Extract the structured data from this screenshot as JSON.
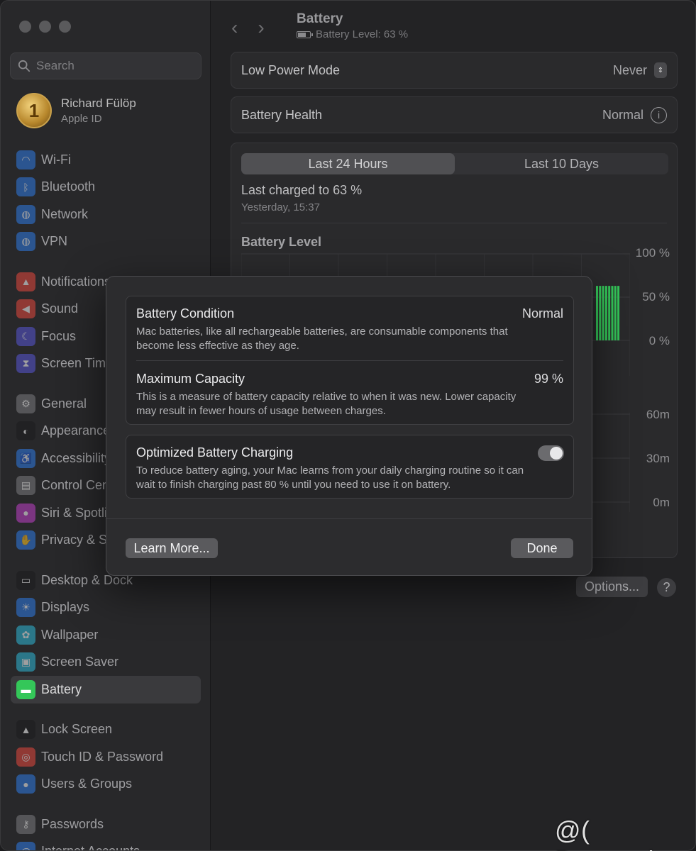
{
  "search": {
    "placeholder": "Search"
  },
  "profile": {
    "name": "Richard Fülöp",
    "subtitle": "Apple ID",
    "avatar_text": "1"
  },
  "sidebar": {
    "groups": [
      [
        {
          "label": "Wi-Fi",
          "icon": "wifi-icon",
          "color": "#2f7ae5"
        },
        {
          "label": "Bluetooth",
          "icon": "bluetooth-icon",
          "color": "#2f7ae5"
        },
        {
          "label": "Network",
          "icon": "globe-icon",
          "color": "#2f7ae5"
        },
        {
          "label": "VPN",
          "icon": "vpn-icon",
          "color": "#2f7ae5"
        }
      ],
      [
        {
          "label": "Notifications",
          "icon": "bell-icon",
          "color": "#e5483d"
        },
        {
          "label": "Sound",
          "icon": "speaker-icon",
          "color": "#e5483d"
        },
        {
          "label": "Focus",
          "icon": "moon-icon",
          "color": "#5856d6"
        },
        {
          "label": "Screen Time",
          "icon": "hourglass-icon",
          "color": "#5856d6"
        }
      ],
      [
        {
          "label": "General",
          "icon": "gear-icon",
          "color": "#7b7b7e"
        },
        {
          "label": "Appearance",
          "icon": "appearance-icon",
          "color": "#1c1c1e"
        },
        {
          "label": "Accessibility",
          "icon": "accessibility-icon",
          "color": "#2f7ae5"
        },
        {
          "label": "Control Centre",
          "icon": "control-centre-icon",
          "color": "#7b7b7e"
        },
        {
          "label": "Siri & Spotlight",
          "icon": "siri-icon",
          "color": "#c040c8"
        },
        {
          "label": "Privacy & Security",
          "icon": "hand-icon",
          "color": "#2f7ae5"
        }
      ],
      [
        {
          "label": "Desktop & Dock",
          "icon": "dock-icon",
          "color": "#1c1c1e"
        },
        {
          "label": "Displays",
          "icon": "sun-icon",
          "color": "#2f7ae5"
        },
        {
          "label": "Wallpaper",
          "icon": "flower-icon",
          "color": "#2fb8d8"
        },
        {
          "label": "Screen Saver",
          "icon": "screen-saver-icon",
          "color": "#2fb8d8"
        },
        {
          "label": "Battery",
          "icon": "battery-icon",
          "color": "#34c759",
          "active": true
        }
      ],
      [
        {
          "label": "Lock Screen",
          "icon": "lock-icon",
          "color": "#1c1c1e"
        },
        {
          "label": "Touch ID & Password",
          "icon": "fingerprint-icon",
          "color": "#e5483d"
        },
        {
          "label": "Users & Groups",
          "icon": "users-icon",
          "color": "#2f7ae5"
        }
      ],
      [
        {
          "label": "Passwords",
          "icon": "key-icon",
          "color": "#7b7b7e"
        },
        {
          "label": "Internet Accounts",
          "icon": "at-icon",
          "color": "#2f7ae5"
        }
      ]
    ]
  },
  "header": {
    "title": "Battery",
    "subtitle": "Battery Level: 63 %",
    "battery_level": 0.63
  },
  "low_power": {
    "label": "Low Power Mode",
    "value": "Never"
  },
  "battery_health": {
    "label": "Battery Health",
    "value": "Normal"
  },
  "usage": {
    "tabs": [
      "Last 24 Hours",
      "Last 10 Days"
    ],
    "active_tab": 0,
    "last_charged": "Last charged to 63 %",
    "last_charged_time": "Yesterday, 15:37",
    "chart_title": "Battery Level",
    "level_axis": [
      "100 %",
      "50 %",
      "0 %"
    ],
    "level_tick_fragment": "3",
    "usage_axis": [
      "60m",
      "30m",
      "0m"
    ],
    "usage_tick_fragment": "3"
  },
  "chart_data": {
    "type": "bar",
    "title": "Battery Level",
    "ylim": [
      0,
      100
    ],
    "visible_bar_count": 8,
    "visible_bar_height_percent": 63,
    "bar_color": "#34c759"
  },
  "footer": {
    "options_label": "Options...",
    "help_label": "?"
  },
  "modal": {
    "condition": {
      "title": "Battery Condition",
      "value": "Normal",
      "desc": "Mac batteries, like all rechargeable batteries, are consumable components that become less effective as they age."
    },
    "capacity": {
      "title": "Maximum Capacity",
      "value": "99 %",
      "desc": "This is a measure of battery capacity relative to when it was new. Lower capacity may result in fewer hours of usage between charges."
    },
    "optimized": {
      "title": "Optimized Battery Charging",
      "desc": "To reduce battery aging, your Mac learns from your daily charging routine so it can wait to finish charging past 80 % until you need to use it on battery.",
      "enabled": true
    },
    "learn_more": "Learn More...",
    "done": "Done"
  },
  "watermark": "@( Bazos.sk"
}
